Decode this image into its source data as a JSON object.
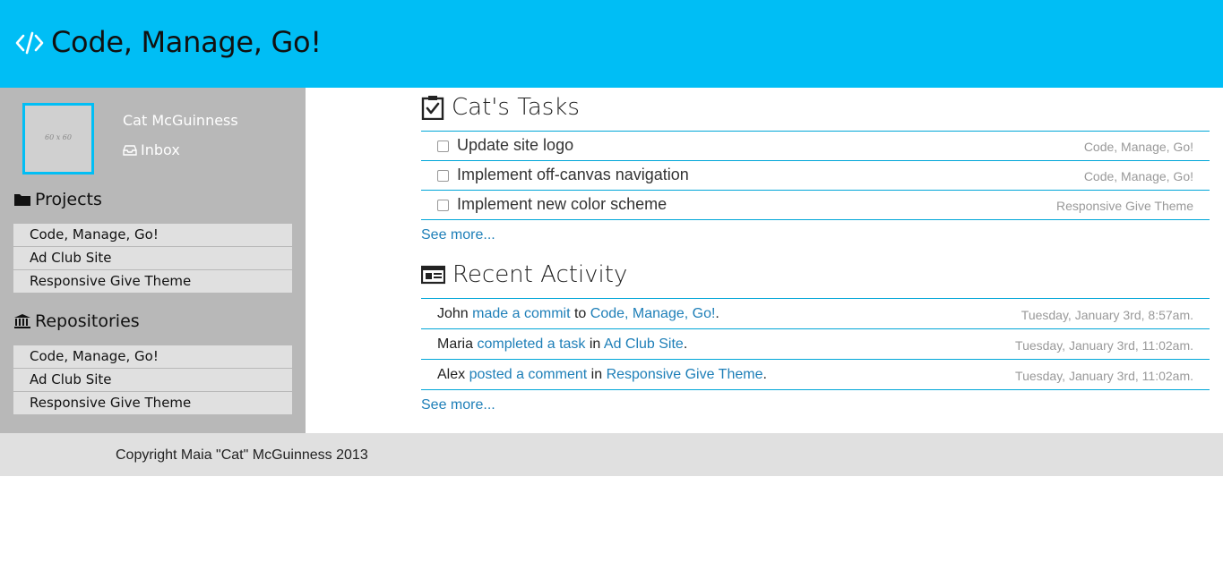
{
  "header": {
    "title": "Code, Manage, Go!",
    "logo_icon": "code-icon",
    "bg_color": "#00bef5"
  },
  "sidebar": {
    "avatar_placeholder": "60 x 60",
    "user_name": "Cat McGuinness",
    "inbox_label": "Inbox",
    "inbox_icon": "inbox-icon",
    "projects": {
      "heading": "Projects",
      "icon": "folder-icon",
      "items": [
        "Code, Manage, Go!",
        "Ad Club Site",
        "Responsive Give Theme"
      ]
    },
    "repositories": {
      "heading": "Repositories",
      "icon": "bank-icon",
      "items": [
        "Code, Manage, Go!",
        "Ad Club Site",
        "Responsive Give Theme"
      ]
    }
  },
  "tasks": {
    "heading": "Cat's Tasks",
    "icon": "clipboard-check-icon",
    "items": [
      {
        "label": "Update site logo",
        "project": "Code, Manage, Go!"
      },
      {
        "label": "Implement off-canvas navigation",
        "project": "Code, Manage, Go!"
      },
      {
        "label": "Implement new color scheme",
        "project": "Responsive Give Theme"
      }
    ],
    "see_more": "See more..."
  },
  "activity": {
    "heading": "Recent Activity",
    "icon": "newspaper-icon",
    "items": [
      {
        "user": "John",
        "action": "made a commit",
        "prep": "to",
        "target": "Code, Manage, Go!",
        "end": ".",
        "time": "Tuesday, January 3rd, 8:57am."
      },
      {
        "user": "Maria",
        "action": "completed a task",
        "prep": "in",
        "target": "Ad Club Site",
        "end": ".",
        "time": "Tuesday, January 3rd, 11:02am."
      },
      {
        "user": "Alex",
        "action": "posted a comment",
        "prep": "in",
        "target": "Responsive Give Theme",
        "end": ".",
        "time": "Tuesday, January 3rd, 11:02am."
      }
    ],
    "see_more": "See more..."
  },
  "footer": {
    "copyright": "Copyright Maia \"Cat\" McGuinness 2013"
  }
}
